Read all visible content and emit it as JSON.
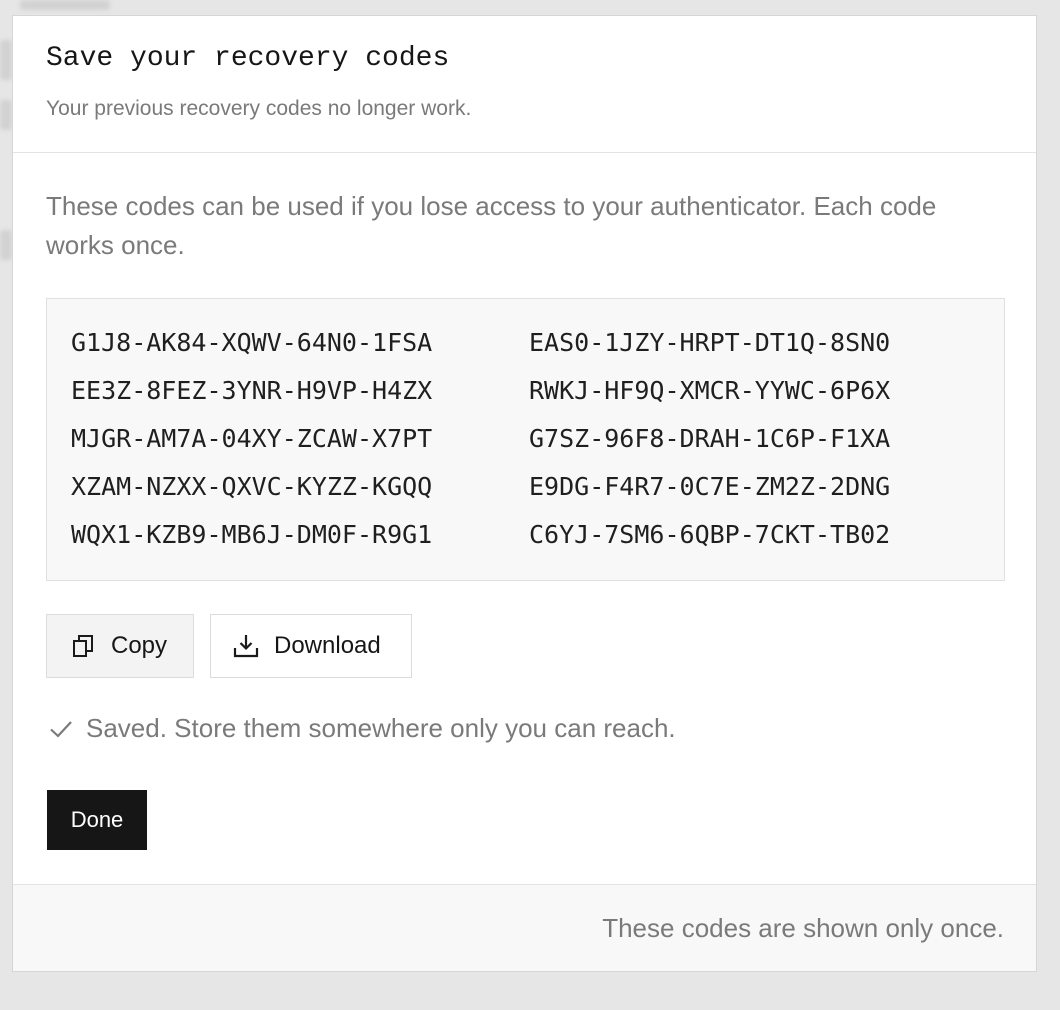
{
  "dialog": {
    "title": "Save your recovery codes",
    "subtitle": "Your previous recovery codes no longer work.",
    "intro": "These codes can be used if you lose access to your authenticator. Each code works once.",
    "codes": [
      "G1J8-AK84-XQWV-64N0-1FSA",
      "EAS0-1JZY-HRPT-DT1Q-8SN0",
      "EE3Z-8FEZ-3YNR-H9VP-H4ZX",
      "RWKJ-HF9Q-XMCR-YYWC-6P6X",
      "MJGR-AM7A-04XY-ZCAW-X7PT",
      "G7SZ-96F8-DRAH-1C6P-F1XA",
      "XZAM-NZXX-QXVC-KYZZ-KGQQ",
      "E9DG-F4R7-0C7E-ZM2Z-2DNG",
      "WQX1-KZB9-MB6J-DM0F-R9G1",
      "C6YJ-7SM6-6QBP-7CKT-TB02"
    ],
    "actions": {
      "copy_label": "Copy",
      "copy_icon": "copy-icon",
      "download_label": "Download",
      "download_icon": "download-icon"
    },
    "status": {
      "icon": "check-icon",
      "text": "Saved. Store them somewhere only you can reach."
    },
    "done_label": "Done",
    "footer_text": "These codes are shown only once."
  },
  "colors": {
    "primary_button": "#161616",
    "muted_text": "#7a7a7a",
    "backdrop": "#e6e6e6"
  }
}
